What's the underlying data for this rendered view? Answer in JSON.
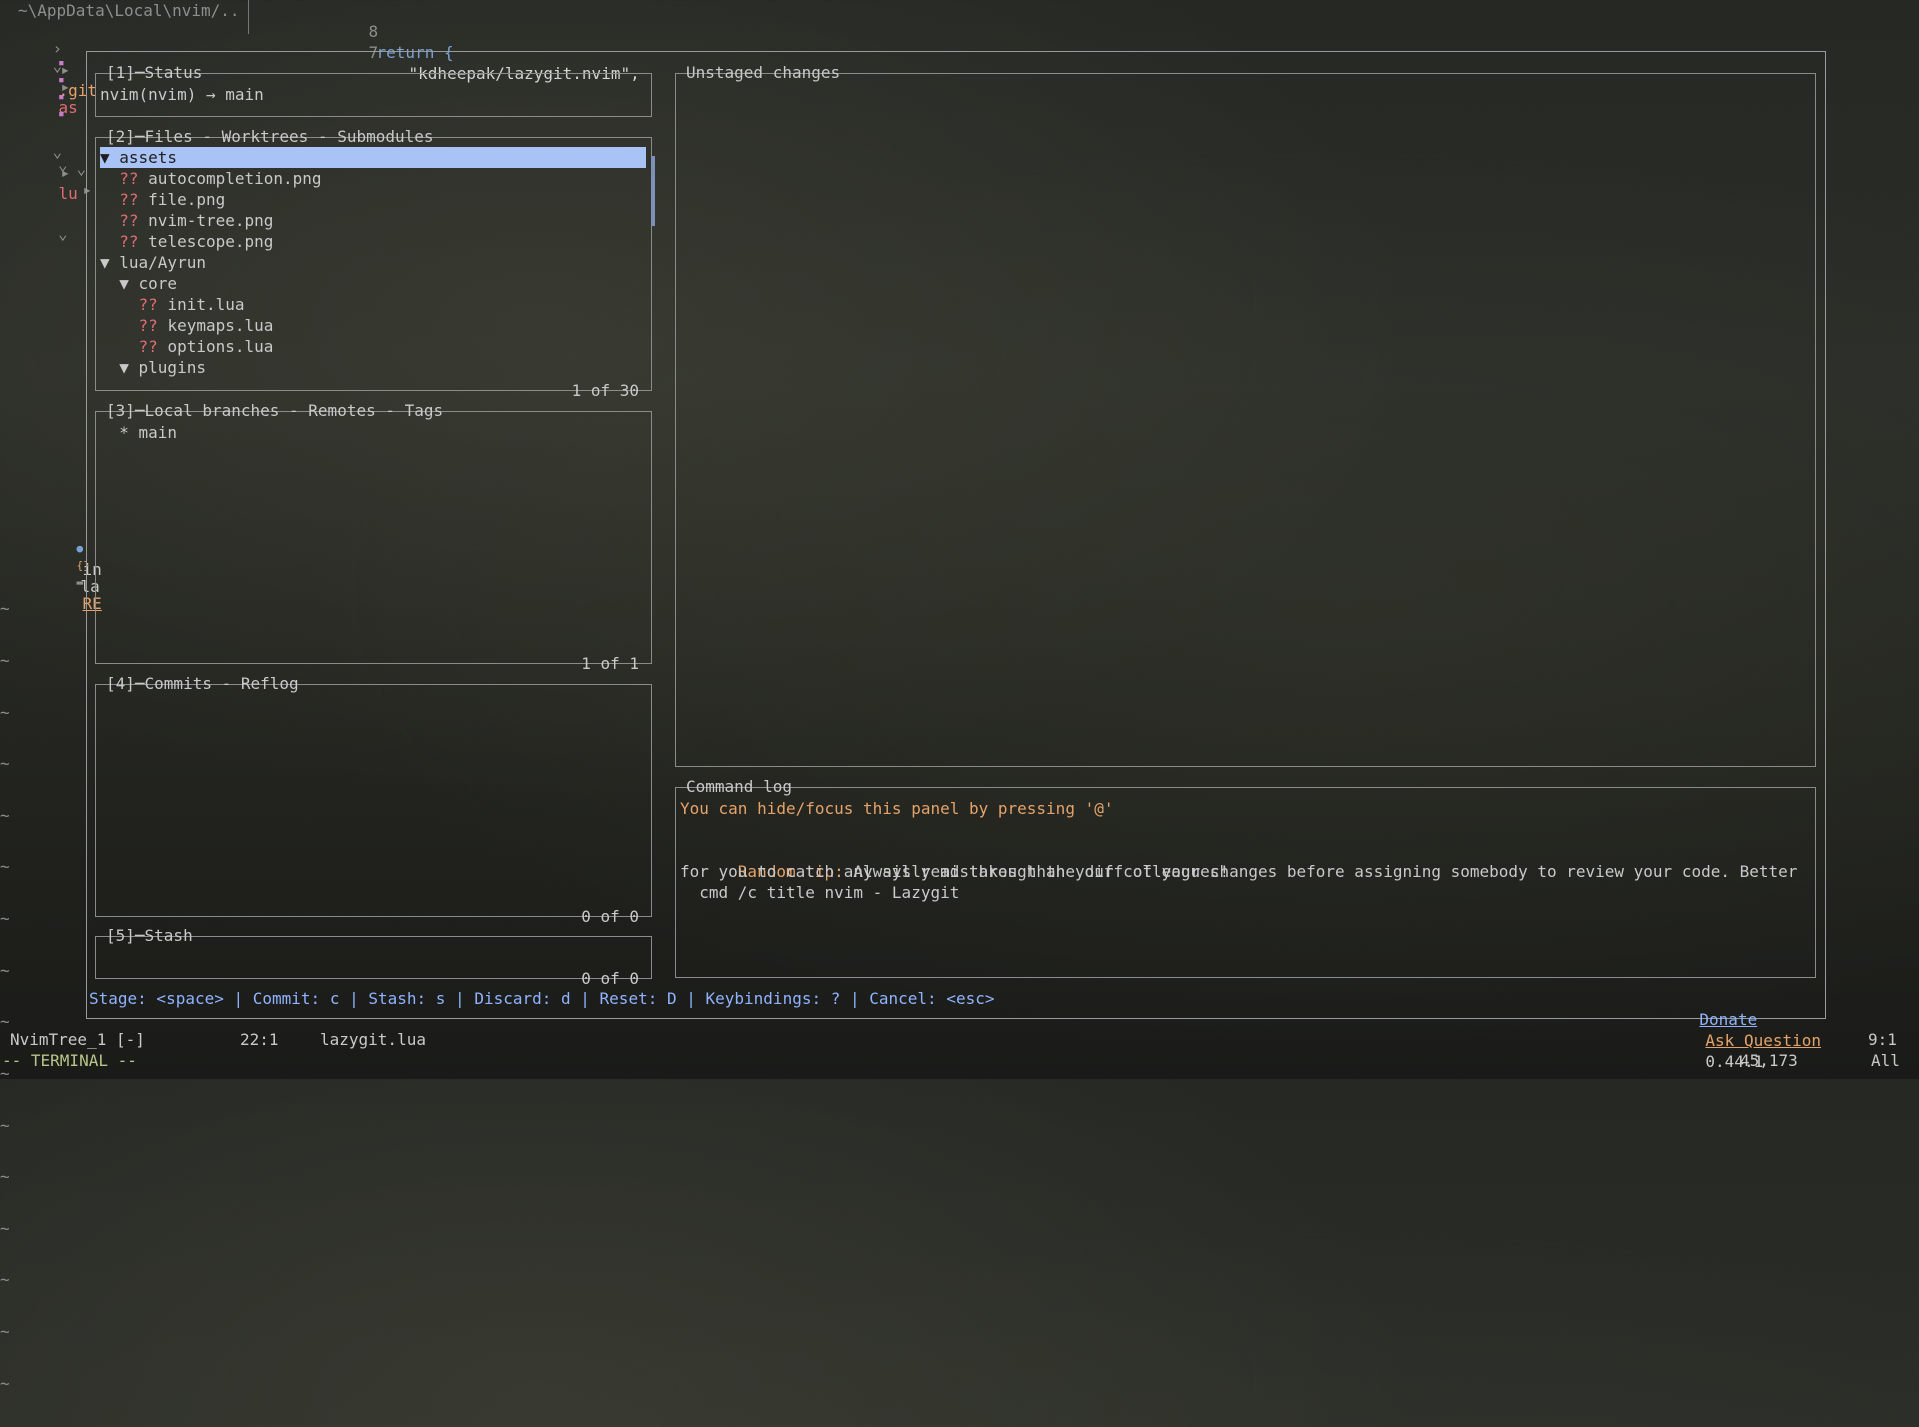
{
  "nvimtree": {
    "path": "~\\AppData\\Local\\nvim/..",
    "items": [
      {
        "chevron": "›",
        "icon": "▸",
        "name": ".git"
      },
      {
        "chevron": "⌄",
        "icon": "▸",
        "name": "as"
      },
      {
        "chevron": "",
        "icon": "▪",
        "name": ""
      },
      {
        "chevron": "",
        "icon": "▪",
        "name": ""
      },
      {
        "chevron": "",
        "icon": "▪",
        "name": ""
      },
      {
        "chevron": "",
        "icon": "▪",
        "name": ""
      },
      {
        "chevron": "⌄",
        "icon": "▸",
        "name": "lu"
      },
      {
        "chevron": "⌄",
        "icon": "▸",
        "name": ""
      },
      {
        "chevron": "⌄",
        "icon": "",
        "name": ""
      }
    ],
    "extra_chevron": "⌄",
    "bottom_items": [
      {
        "icon": "●",
        "name": "in"
      },
      {
        "icon": "{}",
        "name": "la"
      },
      {
        "icon": "▬",
        "name": "RE"
      }
    ],
    "tildes": [
      "~",
      "~",
      "~",
      "~",
      "~",
      "~",
      "~",
      "~",
      "~",
      "~",
      "~",
      "~",
      "~",
      "~",
      "~",
      "~"
    ]
  },
  "editor": {
    "line8_num": "8",
    "line8_code": "return {",
    "line7_num": "7",
    "line7_code": "\"kdheepak/lazygit.nvim\","
  },
  "lazygit": {
    "status": {
      "title": "[1]─Status",
      "text": "nvim(nvim) → main"
    },
    "files": {
      "title": "[2]─Files - Worktrees - Submodules",
      "footer": "1 of 30",
      "rows": [
        {
          "indent": "",
          "prefix": "▼ ",
          "status": "",
          "name": "assets",
          "selected": true
        },
        {
          "indent": "  ",
          "prefix": "",
          "status": "?? ",
          "name": "autocompletion.png",
          "selected": false
        },
        {
          "indent": "  ",
          "prefix": "",
          "status": "?? ",
          "name": "file.png",
          "selected": false
        },
        {
          "indent": "  ",
          "prefix": "",
          "status": "?? ",
          "name": "nvim-tree.png",
          "selected": false
        },
        {
          "indent": "  ",
          "prefix": "",
          "status": "?? ",
          "name": "telescope.png",
          "selected": false
        },
        {
          "indent": "",
          "prefix": "▼ ",
          "status": "",
          "name": "lua/Ayrun",
          "selected": false
        },
        {
          "indent": "  ",
          "prefix": "▼ ",
          "status": "",
          "name": "core",
          "selected": false
        },
        {
          "indent": "    ",
          "prefix": "",
          "status": "?? ",
          "name": "init.lua",
          "selected": false
        },
        {
          "indent": "    ",
          "prefix": "",
          "status": "?? ",
          "name": "keymaps.lua",
          "selected": false
        },
        {
          "indent": "    ",
          "prefix": "",
          "status": "?? ",
          "name": "options.lua",
          "selected": false
        },
        {
          "indent": "  ",
          "prefix": "▼ ",
          "status": "",
          "name": "plugins",
          "selected": false
        }
      ]
    },
    "branches": {
      "title": "[3]─Local branches - Remotes - Tags",
      "footer": "1 of 1",
      "rows": [
        "  * main"
      ]
    },
    "commits": {
      "title": "[4]─Commits - Reflog",
      "footer": "0 of 0"
    },
    "stash": {
      "title": "[5]─Stash",
      "footer": "0 of 0"
    },
    "unstaged": {
      "title": "Unstaged changes"
    },
    "command_log": {
      "title": "Command log",
      "hint": "You can hide/focus this panel by pressing '@'",
      "tip_label": "Random tip:",
      "tip_text": " Always read through the diff of your changes before assigning somebody to review your code. Better",
      "tip_text2": "for you to catch any silly mistakes than your colleagues!",
      "cmd": "  cmd /c title nvim - Lazygit"
    },
    "keybar": {
      "text": "Stage: <space> | Commit: c | Stash: s | Discard: d | Reset: D | Keybindings: ? | Cancel: <esc>",
      "donate": "Donate",
      "ask": "Ask Question",
      "version": "0.44.1"
    }
  },
  "statusline": {
    "left": "NvimTree_1 [-]",
    "pos_left": "22:1",
    "file": "lazygit.lua",
    "pos_right": "9:1",
    "mode": "-- TERMINAL --",
    "coords": "45,173",
    "scroll": "All"
  }
}
